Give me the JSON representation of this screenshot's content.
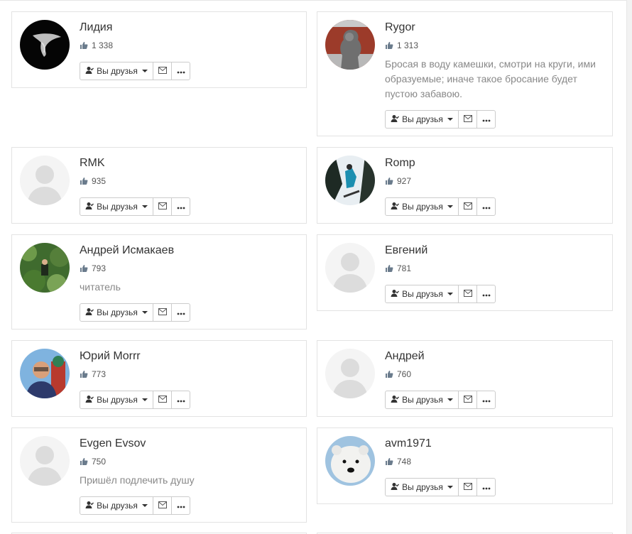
{
  "actions": {
    "friends_label": "Вы друзья"
  },
  "users": [
    {
      "name": "Лидия",
      "likes": "1 338",
      "status": "",
      "avatar": "dark-silhouette"
    },
    {
      "name": "Rygor",
      "likes": "1 313",
      "status": "Бросая в воду камешки, смотри на круги, ими образуемые; иначе такое бросание будет пустою забавою.",
      "avatar": "stone-lion-statue"
    },
    {
      "name": "RMK",
      "likes": "935",
      "status": "",
      "avatar": "default"
    },
    {
      "name": "Romp",
      "likes": "927",
      "status": "",
      "avatar": "snowboarder-forest"
    },
    {
      "name": "Андрей Исмакаев",
      "likes": "793",
      "status": "читатель",
      "avatar": "person-in-forest"
    },
    {
      "name": "Евгений",
      "likes": "781",
      "status": "",
      "avatar": "default"
    },
    {
      "name": "Юрий Morrr",
      "likes": "773",
      "status": "",
      "avatar": "man-at-cathedral"
    },
    {
      "name": "Андрей",
      "likes": "760",
      "status": "",
      "avatar": "default"
    },
    {
      "name": "Evgen Evsov",
      "likes": "750",
      "status": "Пришёл подлечить душу",
      "avatar": "default"
    },
    {
      "name": "avm1971",
      "likes": "748",
      "status": "",
      "avatar": "polar-bear"
    }
  ]
}
